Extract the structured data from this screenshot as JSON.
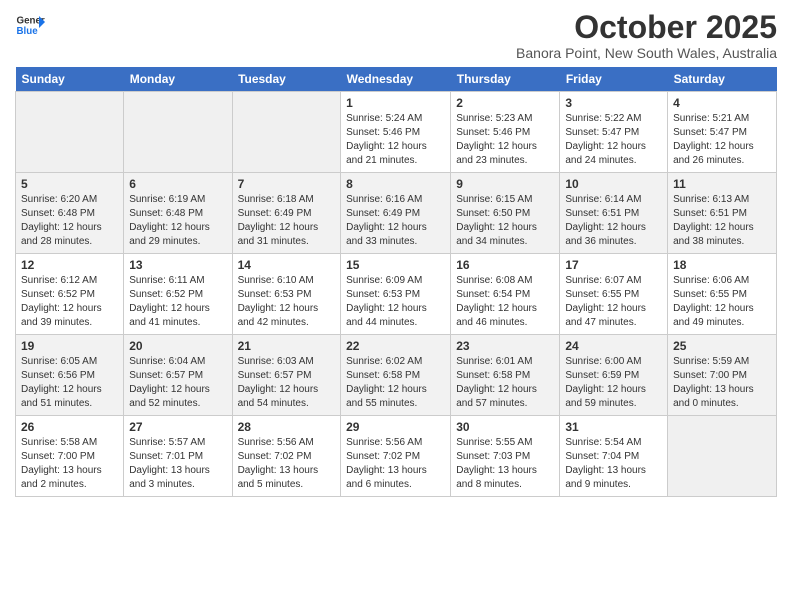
{
  "logo": {
    "line1": "General",
    "line2": "Blue"
  },
  "title": "October 2025",
  "location": "Banora Point, New South Wales, Australia",
  "days_of_week": [
    "Sunday",
    "Monday",
    "Tuesday",
    "Wednesday",
    "Thursday",
    "Friday",
    "Saturday"
  ],
  "weeks": [
    [
      {
        "day": "",
        "text": ""
      },
      {
        "day": "",
        "text": ""
      },
      {
        "day": "",
        "text": ""
      },
      {
        "day": "1",
        "text": "Sunrise: 5:24 AM\nSunset: 5:46 PM\nDaylight: 12 hours\nand 21 minutes."
      },
      {
        "day": "2",
        "text": "Sunrise: 5:23 AM\nSunset: 5:46 PM\nDaylight: 12 hours\nand 23 minutes."
      },
      {
        "day": "3",
        "text": "Sunrise: 5:22 AM\nSunset: 5:47 PM\nDaylight: 12 hours\nand 24 minutes."
      },
      {
        "day": "4",
        "text": "Sunrise: 5:21 AM\nSunset: 5:47 PM\nDaylight: 12 hours\nand 26 minutes."
      }
    ],
    [
      {
        "day": "5",
        "text": "Sunrise: 6:20 AM\nSunset: 6:48 PM\nDaylight: 12 hours\nand 28 minutes."
      },
      {
        "day": "6",
        "text": "Sunrise: 6:19 AM\nSunset: 6:48 PM\nDaylight: 12 hours\nand 29 minutes."
      },
      {
        "day": "7",
        "text": "Sunrise: 6:18 AM\nSunset: 6:49 PM\nDaylight: 12 hours\nand 31 minutes."
      },
      {
        "day": "8",
        "text": "Sunrise: 6:16 AM\nSunset: 6:49 PM\nDaylight: 12 hours\nand 33 minutes."
      },
      {
        "day": "9",
        "text": "Sunrise: 6:15 AM\nSunset: 6:50 PM\nDaylight: 12 hours\nand 34 minutes."
      },
      {
        "day": "10",
        "text": "Sunrise: 6:14 AM\nSunset: 6:51 PM\nDaylight: 12 hours\nand 36 minutes."
      },
      {
        "day": "11",
        "text": "Sunrise: 6:13 AM\nSunset: 6:51 PM\nDaylight: 12 hours\nand 38 minutes."
      }
    ],
    [
      {
        "day": "12",
        "text": "Sunrise: 6:12 AM\nSunset: 6:52 PM\nDaylight: 12 hours\nand 39 minutes."
      },
      {
        "day": "13",
        "text": "Sunrise: 6:11 AM\nSunset: 6:52 PM\nDaylight: 12 hours\nand 41 minutes."
      },
      {
        "day": "14",
        "text": "Sunrise: 6:10 AM\nSunset: 6:53 PM\nDaylight: 12 hours\nand 42 minutes."
      },
      {
        "day": "15",
        "text": "Sunrise: 6:09 AM\nSunset: 6:53 PM\nDaylight: 12 hours\nand 44 minutes."
      },
      {
        "day": "16",
        "text": "Sunrise: 6:08 AM\nSunset: 6:54 PM\nDaylight: 12 hours\nand 46 minutes."
      },
      {
        "day": "17",
        "text": "Sunrise: 6:07 AM\nSunset: 6:55 PM\nDaylight: 12 hours\nand 47 minutes."
      },
      {
        "day": "18",
        "text": "Sunrise: 6:06 AM\nSunset: 6:55 PM\nDaylight: 12 hours\nand 49 minutes."
      }
    ],
    [
      {
        "day": "19",
        "text": "Sunrise: 6:05 AM\nSunset: 6:56 PM\nDaylight: 12 hours\nand 51 minutes."
      },
      {
        "day": "20",
        "text": "Sunrise: 6:04 AM\nSunset: 6:57 PM\nDaylight: 12 hours\nand 52 minutes."
      },
      {
        "day": "21",
        "text": "Sunrise: 6:03 AM\nSunset: 6:57 PM\nDaylight: 12 hours\nand 54 minutes."
      },
      {
        "day": "22",
        "text": "Sunrise: 6:02 AM\nSunset: 6:58 PM\nDaylight: 12 hours\nand 55 minutes."
      },
      {
        "day": "23",
        "text": "Sunrise: 6:01 AM\nSunset: 6:58 PM\nDaylight: 12 hours\nand 57 minutes."
      },
      {
        "day": "24",
        "text": "Sunrise: 6:00 AM\nSunset: 6:59 PM\nDaylight: 12 hours\nand 59 minutes."
      },
      {
        "day": "25",
        "text": "Sunrise: 5:59 AM\nSunset: 7:00 PM\nDaylight: 13 hours\nand 0 minutes."
      }
    ],
    [
      {
        "day": "26",
        "text": "Sunrise: 5:58 AM\nSunset: 7:00 PM\nDaylight: 13 hours\nand 2 minutes."
      },
      {
        "day": "27",
        "text": "Sunrise: 5:57 AM\nSunset: 7:01 PM\nDaylight: 13 hours\nand 3 minutes."
      },
      {
        "day": "28",
        "text": "Sunrise: 5:56 AM\nSunset: 7:02 PM\nDaylight: 13 hours\nand 5 minutes."
      },
      {
        "day": "29",
        "text": "Sunrise: 5:56 AM\nSunset: 7:02 PM\nDaylight: 13 hours\nand 6 minutes."
      },
      {
        "day": "30",
        "text": "Sunrise: 5:55 AM\nSunset: 7:03 PM\nDaylight: 13 hours\nand 8 minutes."
      },
      {
        "day": "31",
        "text": "Sunrise: 5:54 AM\nSunset: 7:04 PM\nDaylight: 13 hours\nand 9 minutes."
      },
      {
        "day": "",
        "text": ""
      }
    ]
  ]
}
